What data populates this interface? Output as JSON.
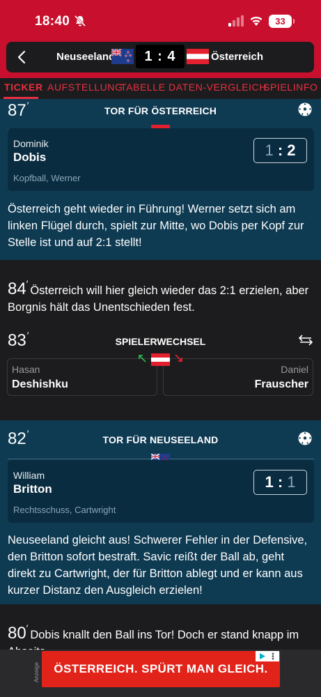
{
  "status_bar": {
    "time": "18:40",
    "battery": "33"
  },
  "match": {
    "home_team": "Neuseeland",
    "away_team": "Österreich",
    "score": "1 : 4"
  },
  "tabs": [
    "TICKER",
    "AUFSTELLUNG",
    "TABELLE",
    "DATEN-VERGLEICH",
    "SPIELINFO"
  ],
  "events": {
    "goal_87": {
      "minute": "87",
      "title": "TOR FÜR ÖSTERREICH",
      "first_name": "Dominik",
      "last_name": "Dobis",
      "detail": "Kopfball, Werner",
      "score_left": "1",
      "score_sep": ":",
      "score_right": "2",
      "text": "Österreich geht wieder in Führung! Werner setzt sich am linken Flügel durch, spielt zur Mitte, wo Dobis per Kopf zur Stelle ist und auf 2:1 stellt!"
    },
    "note_84": {
      "minute": "84",
      "text": "Österreich will hier gleich wieder das 2:1 erzielen, aber Borgnis hält das Unentschieden fest."
    },
    "sub_83": {
      "minute": "83",
      "title": "SPIELERWECHSEL",
      "out_first": "Hasan",
      "out_last": "Deshishku",
      "in_first": "Daniel",
      "in_last": "Frauscher"
    },
    "goal_82": {
      "minute": "82",
      "title": "TOR FÜR NEUSEELAND",
      "first_name": "William",
      "last_name": "Britton",
      "detail": "Rechtsschuss, Cartwright",
      "score_left": "1",
      "score_sep": ":",
      "score_right": "1",
      "text": "Neuseeland gleicht aus! Schwerer Fehler in der Defensive, den Britton sofort bestraft. Savic reißt der Ball ab, geht direkt zu Cartwright, der für Britton ablegt und er kann aus kurzer Distanz den Ausgleich erzielen!"
    },
    "note_80": {
      "minute": "80",
      "text": "Dobis knallt den Ball ins Tor! Doch er stand knapp im Abseits."
    }
  },
  "ad": {
    "label": "Anzeige",
    "text": "ÖSTERREICH. SPÜRT MAN GLEICH."
  },
  "colors": {
    "brand_red": "#c8102e",
    "tab_red": "#e8303f",
    "goal_bg": "#0e3a52",
    "dark_bg": "#1c1c1e"
  }
}
